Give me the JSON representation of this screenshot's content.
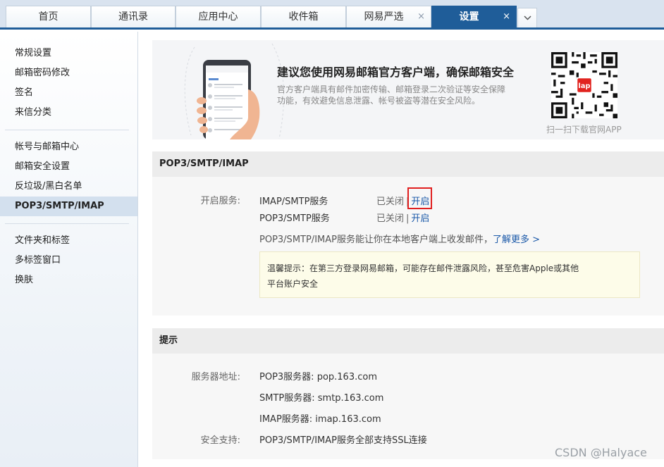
{
  "tabs": [
    {
      "label": "首页"
    },
    {
      "label": "通讯录"
    },
    {
      "label": "应用中心"
    },
    {
      "label": "收件箱"
    },
    {
      "label": "网易严选",
      "close": "×"
    },
    {
      "label": "设置",
      "close": "×"
    }
  ],
  "sidebar": {
    "items": [
      {
        "label": "常规设置"
      },
      {
        "label": "邮箱密码修改"
      },
      {
        "label": "签名"
      },
      {
        "label": "来信分类"
      },
      {
        "label": "帐号与邮箱中心"
      },
      {
        "label": "邮箱安全设置"
      },
      {
        "label": "反垃圾/黑白名单"
      },
      {
        "label": "POP3/SMTP/IMAP"
      },
      {
        "label": "文件夹和标签"
      },
      {
        "label": "多标签窗口"
      },
      {
        "label": "换肤"
      }
    ]
  },
  "banner": {
    "title": "建议您使用网易邮箱官方客户端，确保邮箱安全",
    "desc": "官方客户端具有邮件加密传输、邮箱登录二次验证等安全保障功能，有效避免信息泄露、帐号被盗等潜在安全风险。",
    "qr_caption": "扫一扫下载官网APP",
    "qr_logo_text": "lap"
  },
  "pop3_section": {
    "title": "POP3/SMTP/IMAP",
    "services_label": "开启服务:",
    "services": [
      {
        "name": "IMAP/SMTP服务",
        "status": "已关闭",
        "sep": "|",
        "action": "开启"
      },
      {
        "name": "POP3/SMTP服务",
        "status": "已关闭",
        "sep": "|",
        "action": "开启"
      }
    ],
    "info_text": "POP3/SMTP/IMAP服务能让你在本地客户端上收发邮件，",
    "learn_more": "了解更多 >",
    "warning_line1": "温馨提示：在第三方登录网易邮箱，可能存在邮件泄露风险，甚至危害Apple或其他",
    "warning_line2": "平台账户安全"
  },
  "tips_section": {
    "title": "提示",
    "server_label": "服务器地址:",
    "servers": [
      {
        "text": "POP3服务器: pop.163.com"
      },
      {
        "text": "SMTP服务器: smtp.163.com"
      },
      {
        "text": "IMAP服务器: imap.163.com"
      }
    ],
    "security_label": "安全支持:",
    "security_text": "POP3/SMTP/IMAP服务全部支持SSL连接"
  },
  "watermark": "CSDN @Halyace",
  "colors": {
    "accent": "#1f5d99",
    "link": "#1a58a8",
    "highlight": "#e02020",
    "warning_bg": "#fdfce9"
  }
}
